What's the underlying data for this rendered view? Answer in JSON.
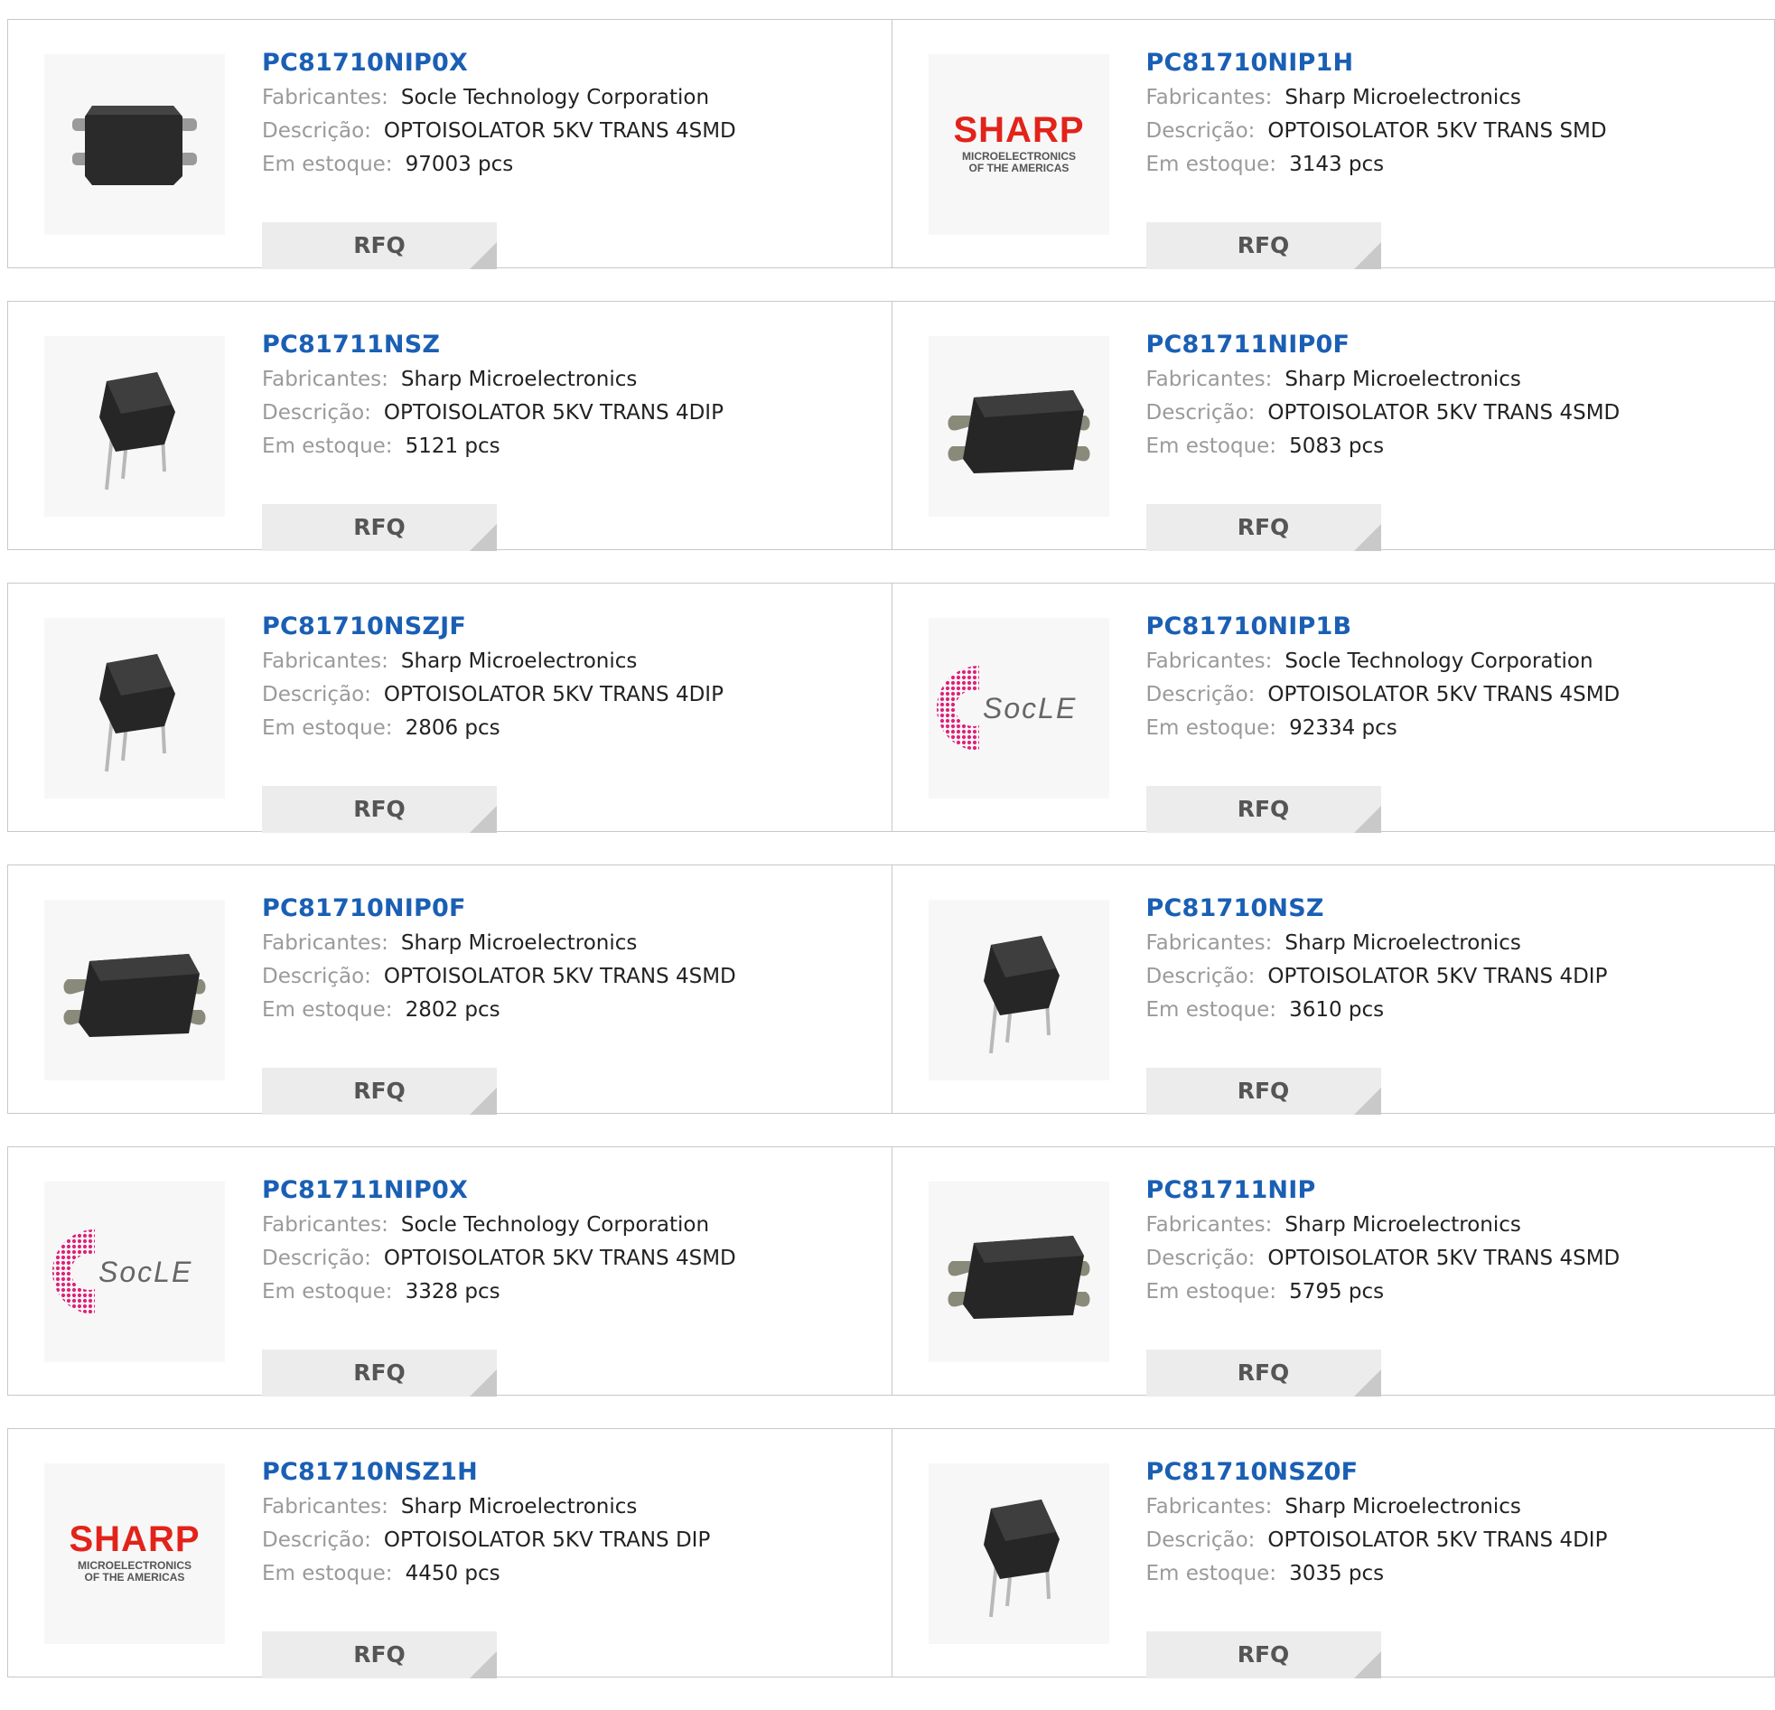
{
  "labels": {
    "manufacturer": "Fabricantes:",
    "description": "Descrição:",
    "stock": "Em estoque:",
    "rfq": "RFQ"
  },
  "products": [
    {
      "part": "PC81710NIP0X",
      "manufacturer": "Socle Technology Corporation",
      "description": "OPTOISOLATOR 5KV TRANS 4SMD",
      "stock": "97003 pcs",
      "image": "smd-chip-small-icon"
    },
    {
      "part": "PC81710NIP1H",
      "manufacturer": "Sharp Microelectronics",
      "description": "OPTOISOLATOR 5KV TRANS SMD",
      "stock": "3143 pcs",
      "image": "sharp-logo",
      "logo_text": {
        "brand": "SHARP",
        "line1": "MICROELECTRONICS",
        "line2": "OF THE AMERICAS"
      }
    },
    {
      "part": "PC81711NSZ",
      "manufacturer": "Sharp Microelectronics",
      "description": "OPTOISOLATOR 5KV TRANS 4DIP",
      "stock": "5121 pcs",
      "image": "dip-chip-icon"
    },
    {
      "part": "PC81711NIP0F",
      "manufacturer": "Sharp Microelectronics",
      "description": "OPTOISOLATOR 5KV TRANS 4SMD",
      "stock": "5083 pcs",
      "image": "smd-chip-icon"
    },
    {
      "part": "PC81710NSZJF",
      "manufacturer": "Sharp Microelectronics",
      "description": "OPTOISOLATOR 5KV TRANS 4DIP",
      "stock": "2806 pcs",
      "image": "dip-chip-icon"
    },
    {
      "part": "PC81710NIP1B",
      "manufacturer": "Socle Technology Corporation",
      "description": "OPTOISOLATOR 5KV TRANS 4SMD",
      "stock": "92334 pcs",
      "image": "socle-logo",
      "logo_text": {
        "brand": "SocLE"
      }
    },
    {
      "part": "PC81710NIP0F",
      "manufacturer": "Sharp Microelectronics",
      "description": "OPTOISOLATOR 5KV TRANS 4SMD",
      "stock": "2802 pcs",
      "image": "smd-chip-icon"
    },
    {
      "part": "PC81710NSZ",
      "manufacturer": "Sharp Microelectronics",
      "description": "OPTOISOLATOR 5KV TRANS 4DIP",
      "stock": "3610 pcs",
      "image": "dip-chip-icon"
    },
    {
      "part": "PC81711NIP0X",
      "manufacturer": "Socle Technology Corporation",
      "description": "OPTOISOLATOR 5KV TRANS 4SMD",
      "stock": "3328 pcs",
      "image": "socle-logo",
      "logo_text": {
        "brand": "SocLE"
      }
    },
    {
      "part": "PC81711NIP",
      "manufacturer": "Sharp Microelectronics",
      "description": "OPTOISOLATOR 5KV TRANS 4SMD",
      "stock": "5795 pcs",
      "image": "smd-chip-icon"
    },
    {
      "part": "PC81710NSZ1H",
      "manufacturer": "Sharp Microelectronics",
      "description": "OPTOISOLATOR 5KV TRANS DIP",
      "stock": "4450 pcs",
      "image": "sharp-logo",
      "logo_text": {
        "brand": "SHARP",
        "line1": "MICROELECTRONICS",
        "line2": "OF THE AMERICAS"
      }
    },
    {
      "part": "PC81710NSZ0F",
      "manufacturer": "Sharp Microelectronics",
      "description": "OPTOISOLATOR 5KV TRANS 4DIP",
      "stock": "3035 pcs",
      "image": "dip-chip-icon"
    }
  ],
  "colors": {
    "part_link": "#1a5fb4",
    "label": "#9a9a9a",
    "value": "#222222",
    "button_bg": "#ececec",
    "sharp_red": "#e2231a",
    "socle_pink": "#e0217a"
  }
}
